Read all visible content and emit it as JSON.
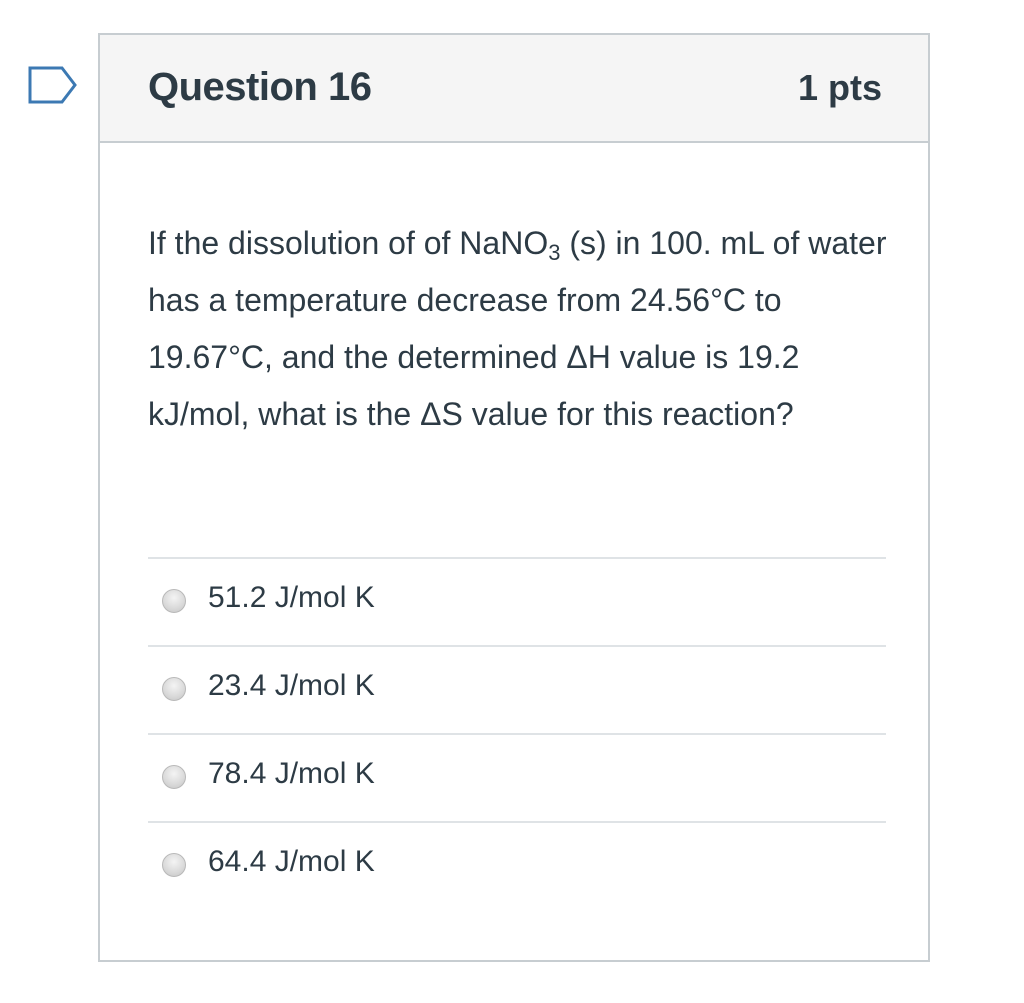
{
  "question": {
    "title": "Question 16",
    "points": "1 pts",
    "text_part1": "If the dissolution of  of NaNO",
    "text_sub": "3",
    "text_part2": " (s) in 100. mL of water has a temperature decrease from 24.56°C to 19.67°C, and the determined ΔH value is 19.2 kJ/mol, what is the ΔS value for this reaction?"
  },
  "answers": [
    {
      "label": "51.2 J/mol K"
    },
    {
      "label": "23.4 J/mol K"
    },
    {
      "label": "78.4 J/mol K"
    },
    {
      "label": "64.4 J/mol K"
    }
  ],
  "colors": {
    "text": "#2d3b45",
    "border": "#c7cdd1",
    "header_bg": "#f5f5f5",
    "flag": "#3c79b3"
  },
  "icons": {
    "flag": "flag-question-icon",
    "radio": "radio-unchecked-icon"
  }
}
